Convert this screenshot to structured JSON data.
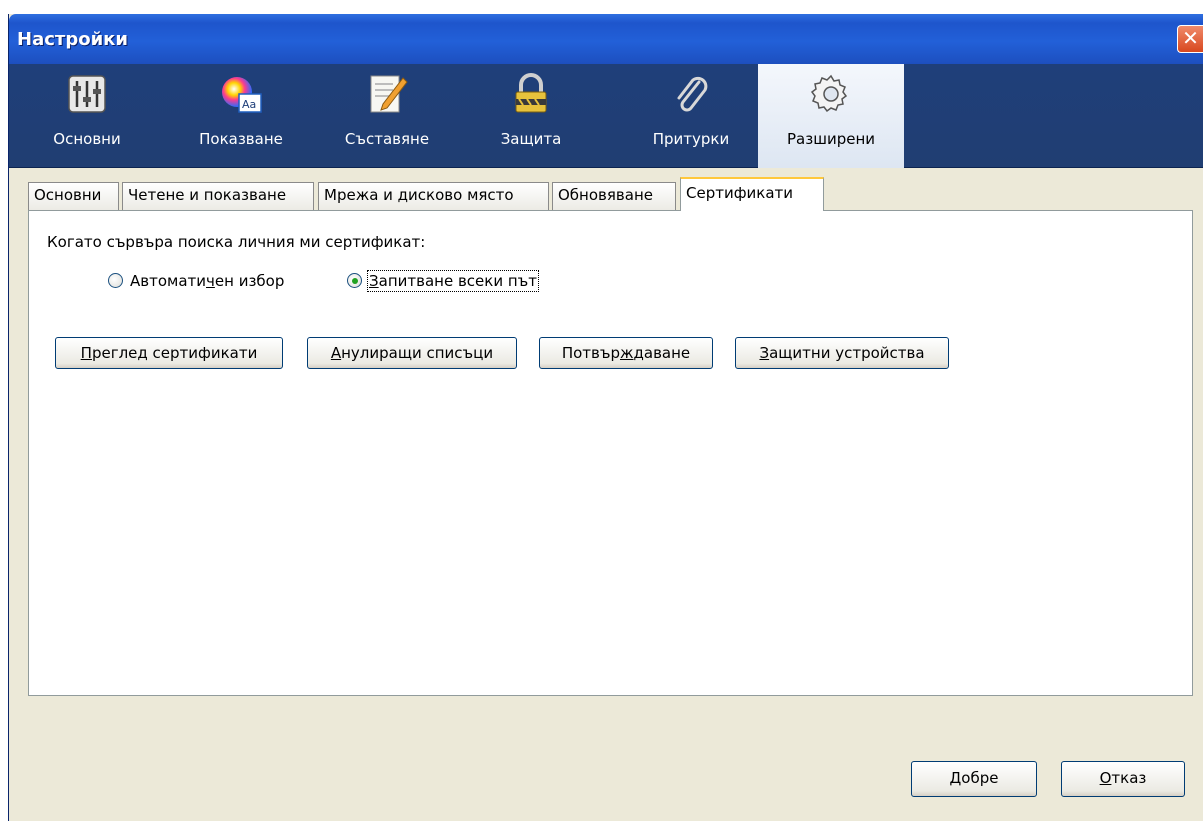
{
  "window": {
    "title": "Настройки",
    "close_glyph": "✕"
  },
  "toolbar": {
    "items": [
      {
        "label": "Основни",
        "icon": "sliders-icon"
      },
      {
        "label": "Показване",
        "icon": "color-font-icon"
      },
      {
        "label": "Съставяне",
        "icon": "compose-pencil-icon"
      },
      {
        "label": "Защита",
        "icon": "lock-icon"
      },
      {
        "label": "Притурки",
        "icon": "paperclip-icon"
      },
      {
        "label": "Разширени",
        "icon": "gear-icon"
      }
    ],
    "selected": "Разширени"
  },
  "subtabs": {
    "items": [
      "Основни",
      "Четене и показване",
      "Мрежа и дисково място",
      "Обновяване",
      "Сертификати"
    ],
    "selected": "Сертификати"
  },
  "certificates": {
    "question": "Когато сървъра поиска личния ми сертификат:",
    "radio_auto": {
      "pre": "Автомати",
      "key": "ч",
      "post": "ен избор",
      "checked": false
    },
    "radio_ask": {
      "pre": "",
      "key": "З",
      "post": "апитване всеки път",
      "checked": true
    },
    "buttons": [
      {
        "pre": "",
        "key": "П",
        "post": "реглед сертификати"
      },
      {
        "pre": "",
        "key": "А",
        "post": "нулиращи списъци"
      },
      {
        "pre": "Потвър",
        "key": "ж",
        "post": "даване"
      },
      {
        "pre": "",
        "key": "З",
        "post": "ащитни устройства"
      }
    ]
  },
  "footer": {
    "ok": {
      "pre": "",
      "key": "Д",
      "post": "обре"
    },
    "cancel": {
      "pre": "",
      "key": "О",
      "post": "тказ"
    }
  },
  "colors": {
    "title_bar": "#2260d8",
    "toolbar_bg": "#203e72",
    "dialog_bg": "#ece9d8",
    "active_tab_accent": "#ffc83c",
    "radio_dot": "#21a121"
  }
}
